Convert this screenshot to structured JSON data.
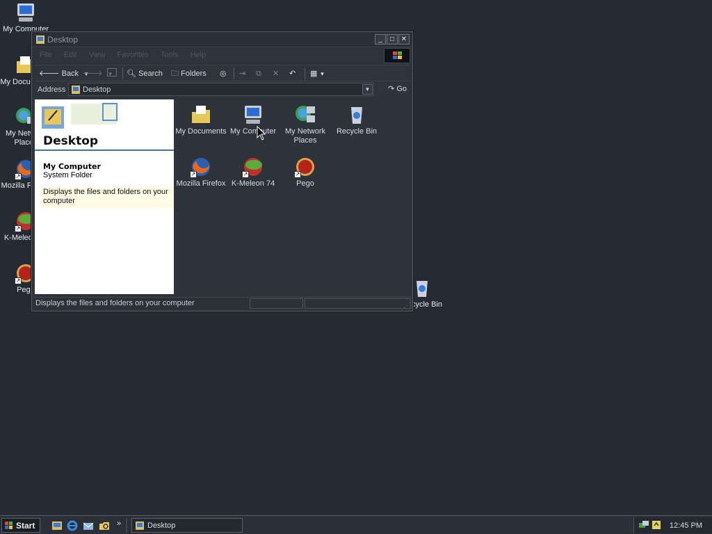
{
  "desktop": {
    "icons": [
      {
        "label": "My Computer",
        "icon": "computer-icon"
      },
      {
        "label": "My Documents",
        "icon": "folder-icon"
      },
      {
        "label": "My Network Places",
        "icon": "network-icon"
      },
      {
        "label": "Mozilla Firefox",
        "icon": "firefox-icon"
      },
      {
        "label": "K-Meleon 74",
        "icon": "kmeleon-icon"
      },
      {
        "label": "Pego",
        "icon": "pego-icon"
      },
      {
        "label": "Recycle Bin",
        "icon": "recycle-bin-icon"
      }
    ]
  },
  "window": {
    "title": "Desktop",
    "controls": {
      "minimize": "_",
      "maximize": "□",
      "close": "✕"
    },
    "menu": [
      "File",
      "Edit",
      "View",
      "Favorites",
      "Tools",
      "Help"
    ],
    "toolbar": {
      "back": "Back",
      "search": "Search",
      "folders": "Folders"
    },
    "address": {
      "label": "Address",
      "value": "Desktop",
      "go": "Go"
    },
    "taskpane": {
      "title": "Desktop",
      "selected_name": "My Computer",
      "selected_type": "System Folder",
      "selected_description": "Displays the files and folders on your computer"
    },
    "items": [
      {
        "label": "My Documents",
        "icon": "folder-icon"
      },
      {
        "label": "My Computer",
        "icon": "computer-icon"
      },
      {
        "label": "My Network Places",
        "icon": "network-icon"
      },
      {
        "label": "Recycle Bin",
        "icon": "recycle-bin-icon"
      },
      {
        "label": "Mozilla Firefox",
        "icon": "firefox-icon"
      },
      {
        "label": "K-Meleon 74",
        "icon": "kmeleon-icon"
      },
      {
        "label": "Pego",
        "icon": "pego-icon"
      }
    ],
    "status": "Displays the files and folders on your computer"
  },
  "taskbar": {
    "start": "Start",
    "task": "Desktop",
    "clock": "12:45 PM"
  },
  "colors": {
    "desktop_bg": "#262b33",
    "window_bg": "#2e333b",
    "pane_bg": "#ffffff",
    "tooltip_bg": "#fffce6",
    "header_rule": "#4c6f9c"
  }
}
